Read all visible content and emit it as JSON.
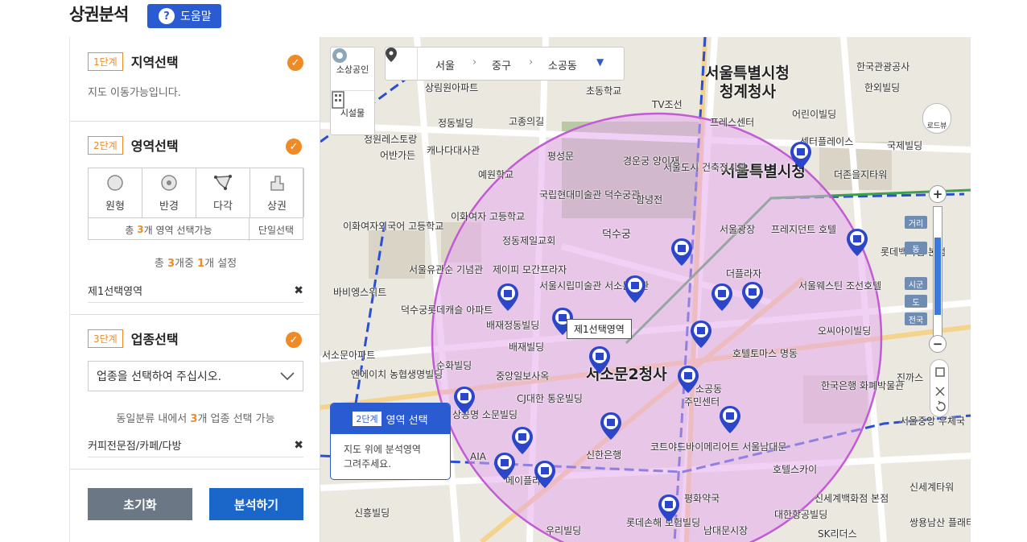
{
  "header": {
    "title": "상권분석",
    "help_label": "도움말"
  },
  "sidebar": {
    "step1": {
      "badge": "1단계",
      "title": "지역선택",
      "hint": "지도 이동가능입니다."
    },
    "step2": {
      "badge": "2단계",
      "title": "영역선택",
      "shapes": [
        {
          "label": "원형",
          "icon": "circle-icon"
        },
        {
          "label": "반경",
          "icon": "radius-icon"
        },
        {
          "label": "다각",
          "icon": "polygon-icon"
        },
        {
          "label": "상권",
          "icon": "district-icon"
        }
      ],
      "foot_prefix": "총",
      "foot_count": "3",
      "foot_suffix": "개 영역 선택가능",
      "single_select": "단일선택",
      "summary_prefix": "총",
      "summary_total": "3",
      "summary_mid": "개중",
      "summary_set": "1",
      "summary_suffix": "개 설정",
      "selected_area": "제1선택영역"
    },
    "step3": {
      "badge": "3단계",
      "title": "업종선택",
      "dropdown_placeholder": "업종을 선택하여 주십시오.",
      "note_prefix": "동일분류 내에서",
      "note_count": "3",
      "note_suffix": "개 업종 선택 가능",
      "selected_industry": "커피전문점/카페/다방"
    },
    "reset_label": "초기화",
    "analyze_label": "분석하기"
  },
  "map": {
    "tools": [
      {
        "label": "소상공인",
        "icon": "shop-icon"
      },
      {
        "label": "시설물",
        "icon": "building-icon"
      }
    ],
    "location": {
      "city": "서울",
      "district": "중구",
      "dong": "소공동"
    },
    "area_label": "제1선택영역",
    "tip": {
      "badge": "2단계",
      "title": "영역 선택",
      "body1": "지도 위에 분석영역",
      "body2": "그려주세요."
    },
    "zoom": {
      "labels": [
        "거리",
        "동",
        "시군",
        "도",
        "전국"
      ],
      "level_fraction": 0.72
    },
    "roadview_label": "로드뷰",
    "place_labels": [
      "서울특별시청",
      "청계청사",
      "서울특별시청",
      "서소문2청사",
      "서울광장",
      "덕수궁",
      "경운궁 양이재",
      "국립현대미술관 덕수궁관",
      "예원학교",
      "이화여자 고등학교",
      "정동제일교회",
      "서울시립미술관 서소문본관",
      "배재정동빌딩",
      "배재빌딩",
      "순화빌딩",
      "중앙일보사옥",
      "CJ대한 통운빌딩",
      "신한은행",
      "평화약국",
      "코트야드바이메리어트 서울남대문",
      "주민센터",
      "호텔토마스 명동",
      "더플라자",
      "프레지던트 호텔",
      "서울웨스틴 조선호텔",
      "오씨아이빌딩",
      "한국은행 화폐박물관",
      "서울중앙 우체국",
      "신세계백화점 본점",
      "롯데백화점 본점",
      "한국관광공사",
      "한외빌딩",
      "어린이빌딩",
      "센터플레이스",
      "국제빌딩",
      "더존을지타워",
      "프레스센터",
      "정동빌딩",
      "고종의길",
      "캐나다대사관",
      "이화여자외국어 고등학교",
      "상림원아파트",
      "평성문",
      "함녕전",
      "서울도시 건축전시관",
      "서울유관순 기념관",
      "덕수궁롯데캐슬 아파트",
      "바비엥스위트",
      "서소문아파트",
      "엔에이치 농협생명빌딩",
      "상공명 소문빌딩",
      "AIA",
      "어반가든",
      "정원레스토랑",
      "TV조선",
      "초동학교",
      "소공동",
      "진까스",
      "신흥빌딩",
      "우리빌딩",
      "호텔스카이",
      "SK리더스",
      "신세계타워",
      "쌍용남산 플래티넘",
      "롯데손해 보험빌딩",
      "남대문시장",
      "대한항공빌딩",
      "제이피 모간프라자",
      "메이플라자"
    ]
  }
}
